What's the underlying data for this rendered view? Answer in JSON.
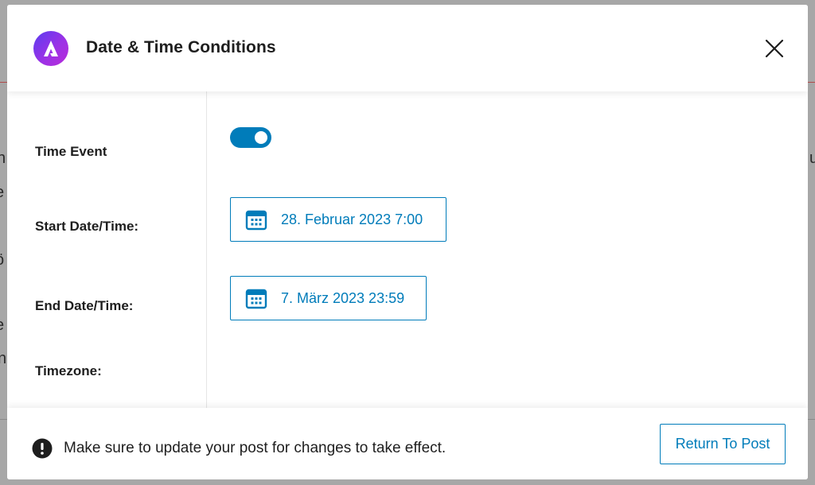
{
  "background": {
    "fragments": [
      "h",
      "e",
      "ö",
      "e",
      "n",
      "u"
    ]
  },
  "modal": {
    "title": "Date & Time Conditions",
    "logo_icon": "astra-logo-icon",
    "close_icon": "close-icon"
  },
  "fields": {
    "time_event_label": "Time Event",
    "time_event_enabled": true,
    "start_label": "Start Date/Time:",
    "start_value": "28. Februar 2023 7:00",
    "end_label": "End Date/Time:",
    "end_value": "7. März 2023 23:59",
    "timezone_label": "Timezone:"
  },
  "footer": {
    "notice_icon": "exclamation-circle-icon",
    "notice_text": "Make sure to update your post for changes to take effect.",
    "return_label": "Return To Post"
  },
  "colors": {
    "accent": "#007cba",
    "logo_gradient_start": "#5a3df0",
    "logo_gradient_end": "#b82cd9",
    "overlay": "#a7a7a7"
  }
}
